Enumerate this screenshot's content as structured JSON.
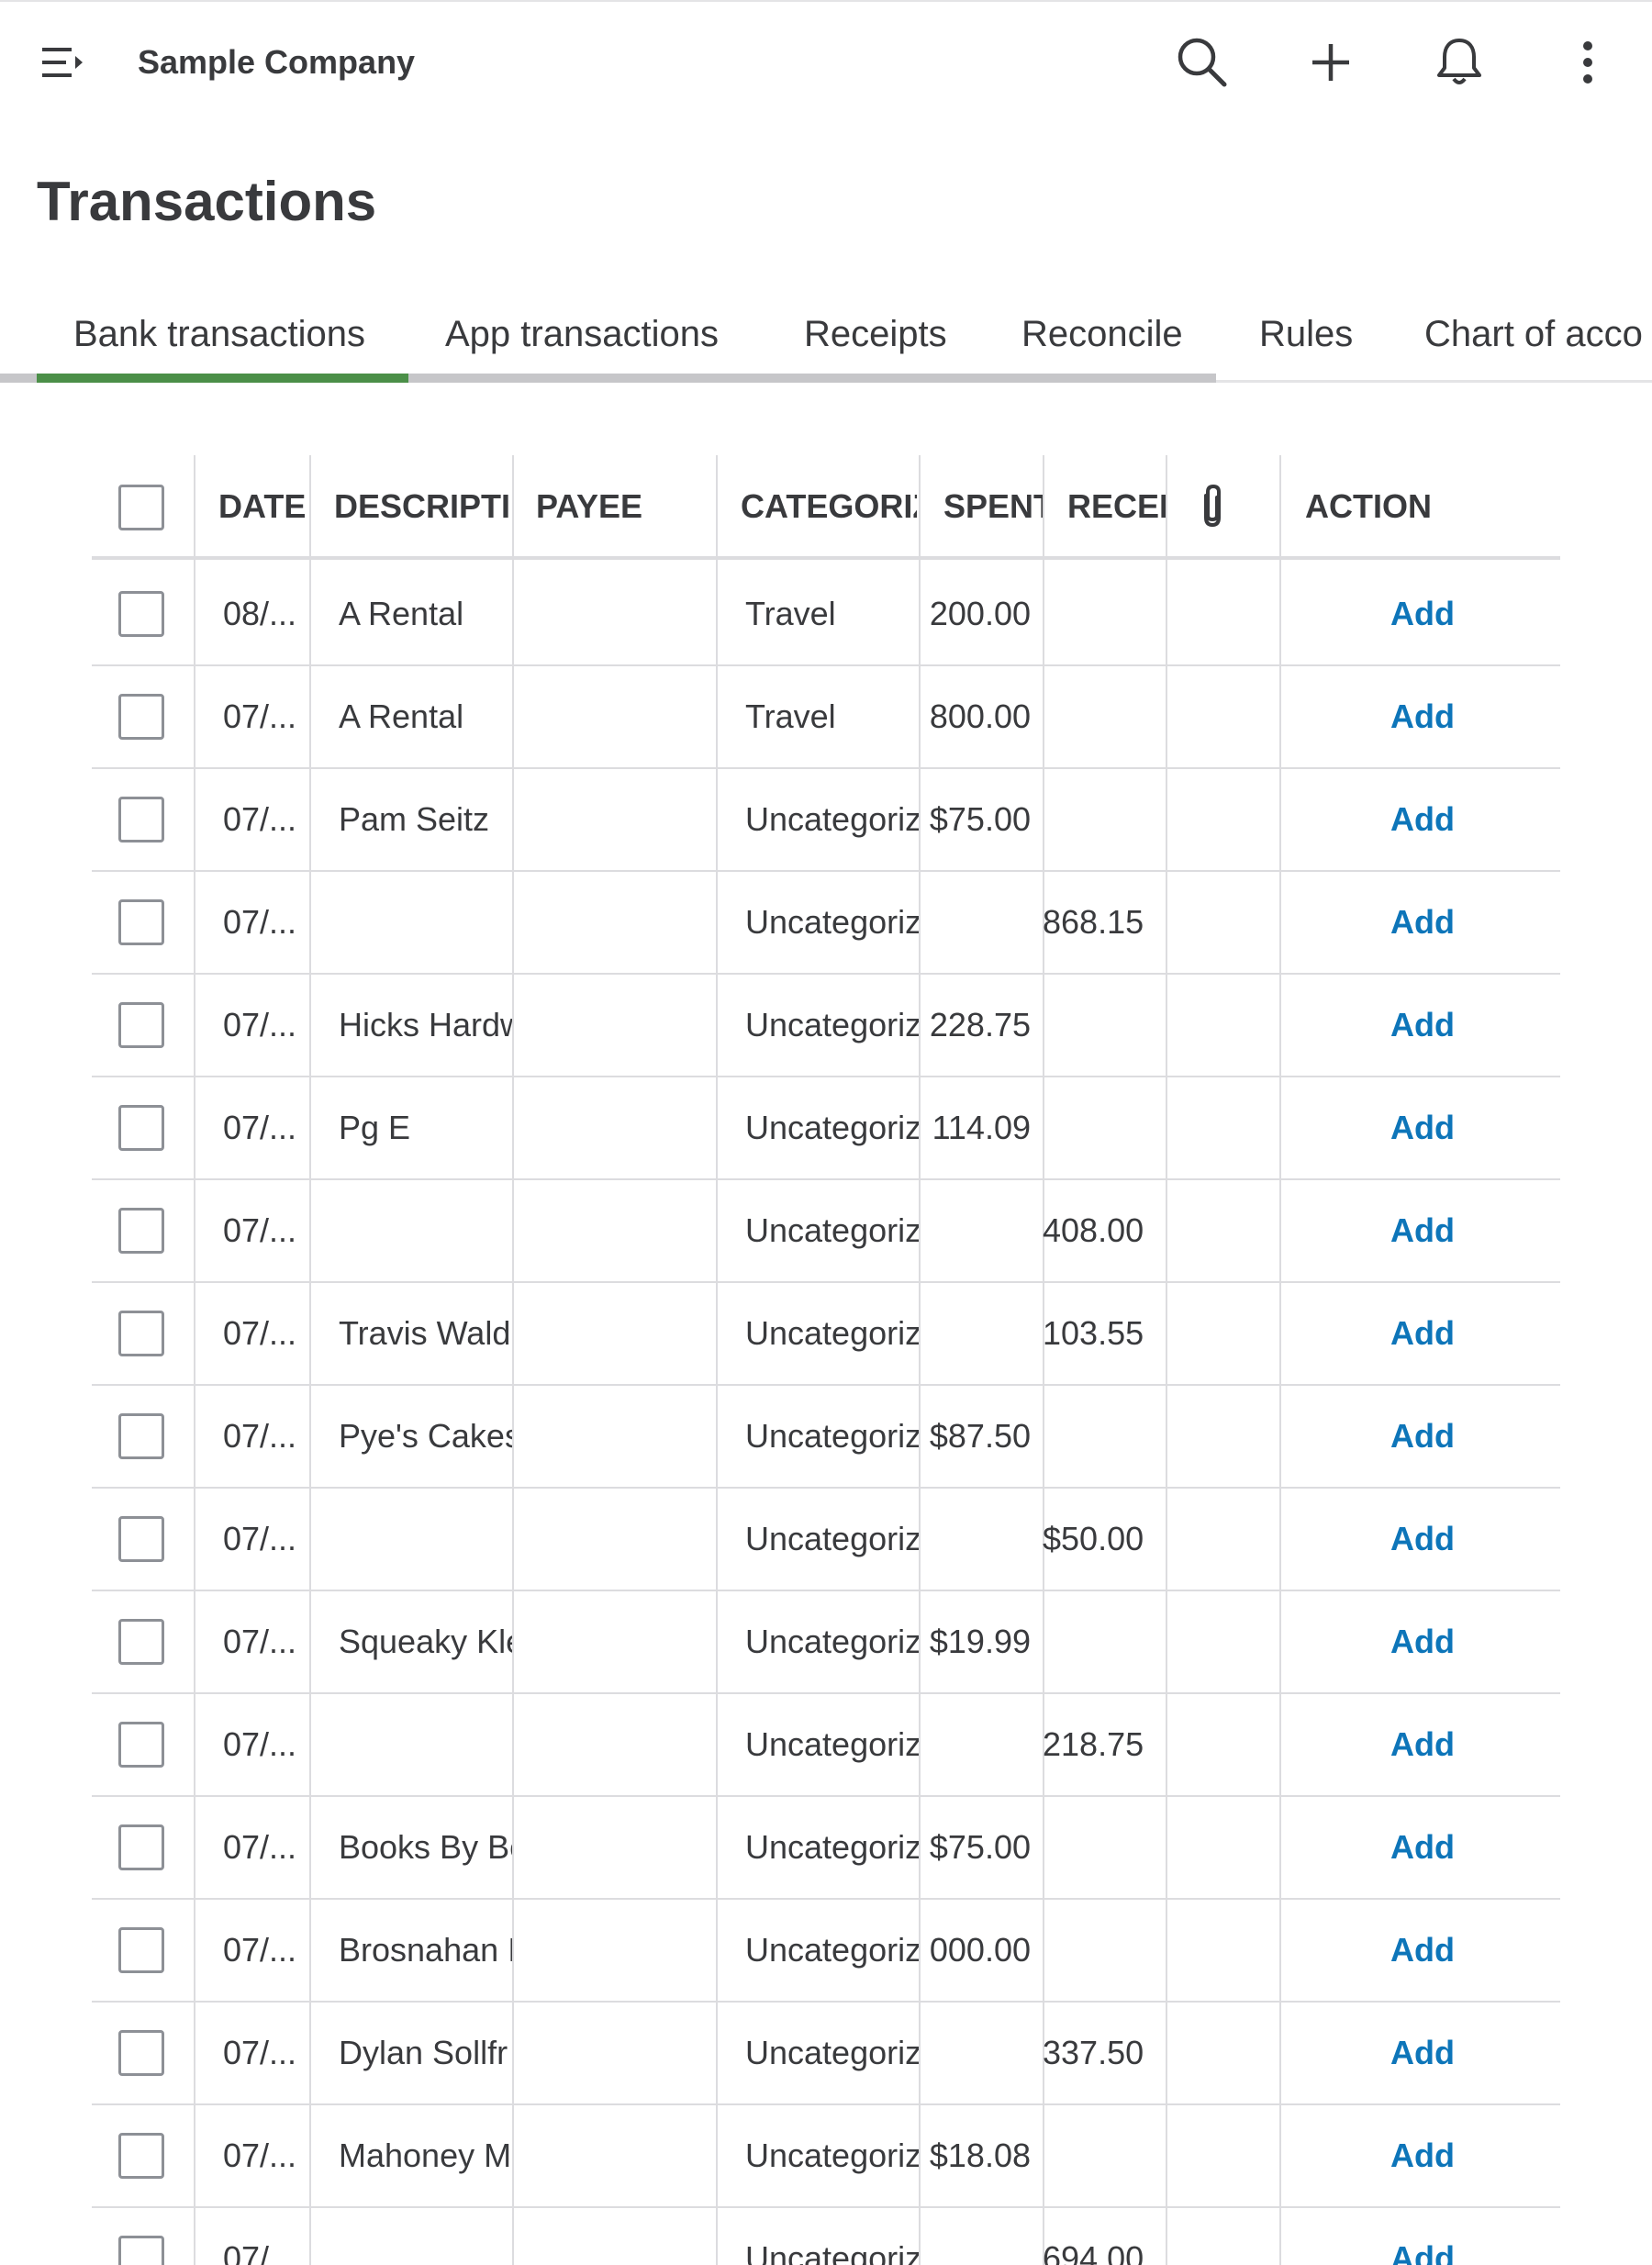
{
  "header": {
    "company": "Sample Company",
    "icons": [
      "menu-icon",
      "search-icon",
      "plus-icon",
      "bell-icon",
      "more-vertical-icon"
    ]
  },
  "page": {
    "title": "Transactions"
  },
  "tabs": [
    {
      "label": "Bank transactions",
      "active": true
    },
    {
      "label": "App transactions"
    },
    {
      "label": "Receipts"
    },
    {
      "label": "Reconcile"
    },
    {
      "label": "Rules"
    },
    {
      "label": "Chart of acco"
    }
  ],
  "table": {
    "columns": {
      "date": "DATE",
      "description": "DESCRIPTIC",
      "payee": "PAYEE",
      "category": "CATEGORIZ",
      "spent": "SPENT",
      "received": "RECEI\\",
      "action": "ACTION"
    },
    "rows": [
      {
        "date": "08/...",
        "description": "A Rental",
        "category": "Travel",
        "spent": "200.00",
        "received": "",
        "action": "Add"
      },
      {
        "date": "07/...",
        "description": "A Rental",
        "category": "Travel",
        "spent": "800.00",
        "received": "",
        "action": "Add"
      },
      {
        "date": "07/...",
        "description": "Pam Seitz",
        "category": "Uncategoriz",
        "spent": "$75.00",
        "received": "",
        "action": "Add"
      },
      {
        "date": "07/...",
        "description": "",
        "category": "Uncategoriz",
        "spent": "",
        "received": "868.15",
        "action": "Add"
      },
      {
        "date": "07/...",
        "description": "Hicks Hardw",
        "category": "Uncategoriz",
        "spent": "228.75",
        "received": "",
        "action": "Add"
      },
      {
        "date": "07/...",
        "description": "Pg E",
        "category": "Uncategoriz",
        "spent": "114.09",
        "received": "",
        "action": "Add"
      },
      {
        "date": "07/...",
        "description": "",
        "category": "Uncategoriz",
        "spent": "",
        "received": "408.00",
        "action": "Add"
      },
      {
        "date": "07/...",
        "description": "Travis Waldr",
        "category": "Uncategoriz",
        "spent": "",
        "received": "103.55",
        "action": "Add"
      },
      {
        "date": "07/...",
        "description": "Pye's Cakes",
        "category": "Uncategoriz",
        "spent": "$87.50",
        "received": "",
        "action": "Add"
      },
      {
        "date": "07/...",
        "description": "",
        "category": "Uncategoriz",
        "spent": "",
        "received": "$50.00",
        "action": "Add"
      },
      {
        "date": "07/...",
        "description": "Squeaky Kle",
        "category": "Uncategoriz",
        "spent": "$19.99",
        "received": "",
        "action": "Add"
      },
      {
        "date": "07/...",
        "description": "",
        "category": "Uncategoriz",
        "spent": "",
        "received": "218.75",
        "action": "Add"
      },
      {
        "date": "07/...",
        "description": "Books By Be",
        "category": "Uncategoriz",
        "spent": "$75.00",
        "received": "",
        "action": "Add"
      },
      {
        "date": "07/...",
        "description": "Brosnahan I",
        "category": "Uncategoriz",
        "spent": "000.00",
        "received": "",
        "action": "Add"
      },
      {
        "date": "07/...",
        "description": "Dylan Sollfr",
        "category": "Uncategoriz",
        "spent": "",
        "received": "337.50",
        "action": "Add"
      },
      {
        "date": "07/...",
        "description": "Mahoney M",
        "category": "Uncategoriz",
        "spent": "$18.08",
        "received": "",
        "action": "Add"
      },
      {
        "date": "07/...",
        "description": "",
        "category": "Uncategoriz",
        "spent": "",
        "received": "694.00",
        "action": "Add"
      }
    ]
  }
}
